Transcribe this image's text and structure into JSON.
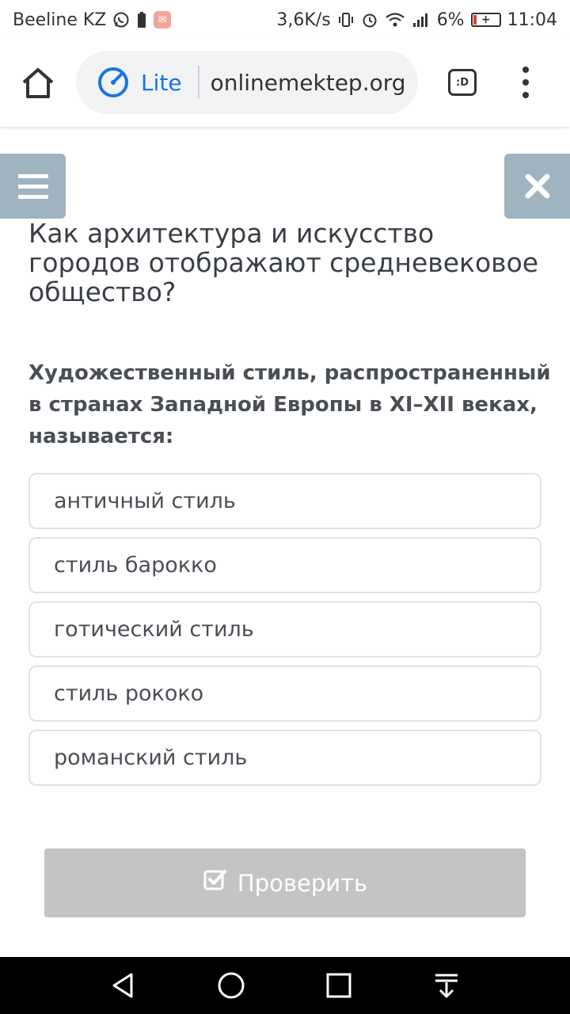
{
  "status_bar": {
    "carrier": "Beeline KZ",
    "network_speed": "3,6K/s",
    "battery_percent": "6%",
    "time": "11:04",
    "icons": [
      "whatsapp-icon",
      "battery-saver-icon",
      "mail-badge-icon",
      "vibrate-icon",
      "alarm-icon",
      "wifi-icon",
      "signal-icon",
      "battery-icon"
    ]
  },
  "browser": {
    "mode_label": "Lite",
    "url": "onlinemektep.org",
    "tabs_label": ":D",
    "accent": "#1a73e8"
  },
  "page": {
    "title": "Как архитектура и искусство городов отображают средневековое общество?",
    "question": "Художественный стиль, распространенный в странах Западной Европы в XI–XII веках, называется:",
    "options": [
      "античный стиль",
      "стиль барокко",
      "готический стиль",
      "стиль рококо",
      "романский стиль"
    ],
    "check_button": "Проверить",
    "side_button_color": "#9fb4c0",
    "check_button_color": "#c4c4c4"
  },
  "nav_bar": {
    "icons": [
      "back-icon",
      "home-circle-icon",
      "recents-icon",
      "notifications-down-icon"
    ]
  }
}
